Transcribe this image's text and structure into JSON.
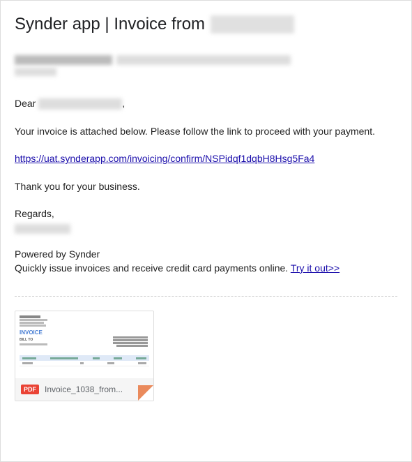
{
  "title": {
    "prefix": "Synder app | Invoice from"
  },
  "body": {
    "dear_prefix": "Dear",
    "comma": ",",
    "attached_text": "Your invoice is attached below. Please follow the link to proceed with your payment.",
    "link_text": "https://uat.synderapp.com/invoicing/confirm/NSPidqf1dqbH8Hsg5Fa4",
    "thank_you": "Thank you for your business.",
    "regards": "Regards,",
    "powered_by": "Powered by Synder",
    "quickly_text": "Quickly issue invoices and receive credit card payments online. ",
    "try_it": "Try it out>>"
  },
  "attachment": {
    "filename": "Invoice_1038_from...",
    "badge": "PDF",
    "preview": {
      "invoice_label": "INVOICE",
      "bill_to": "BILL TO"
    }
  }
}
